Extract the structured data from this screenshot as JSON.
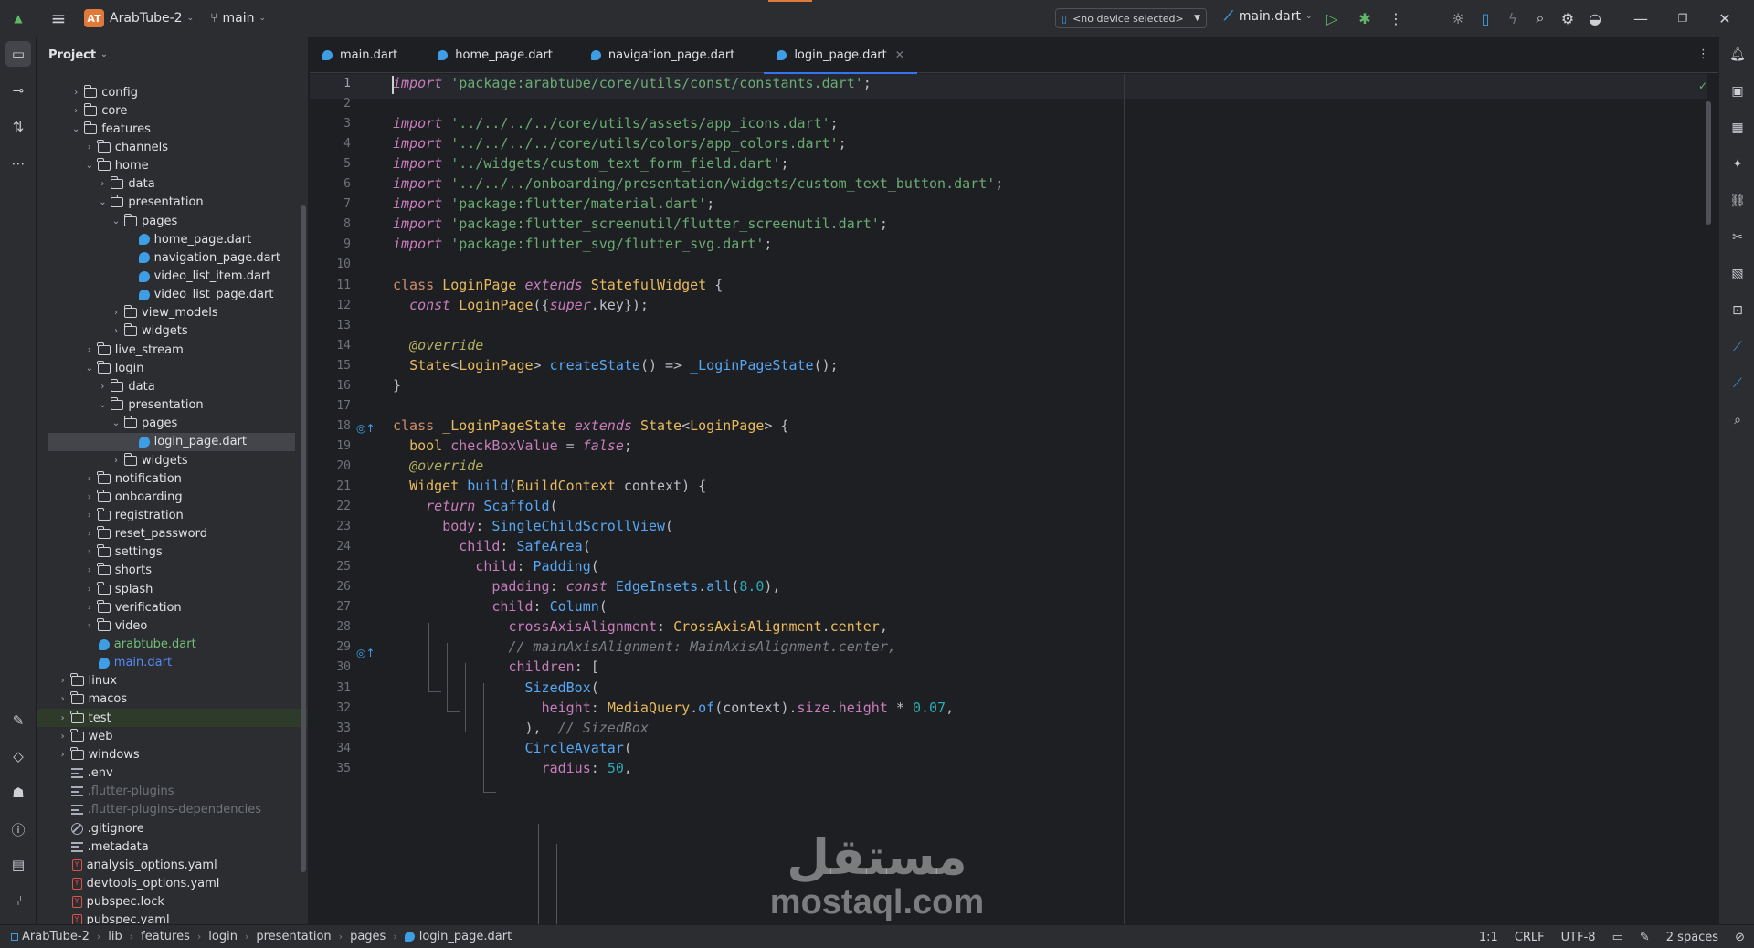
{
  "topbar": {
    "project_badge": "AT",
    "project_name": "ArabTube-2",
    "branch": "main",
    "device": "<no device selected>",
    "run_config": "main.dart"
  },
  "project_panel": {
    "title": "Project",
    "tree": [
      {
        "label": "config",
        "kind": "folder",
        "depth": 2,
        "arrow": "›"
      },
      {
        "label": "core",
        "kind": "folder",
        "depth": 2,
        "arrow": "›"
      },
      {
        "label": "features",
        "kind": "folder",
        "depth": 2,
        "arrow": "⌄"
      },
      {
        "label": "channels",
        "kind": "folder",
        "depth": 3,
        "arrow": "›"
      },
      {
        "label": "home",
        "kind": "folder",
        "depth": 3,
        "arrow": "⌄"
      },
      {
        "label": "data",
        "kind": "folder",
        "depth": 4,
        "arrow": "›"
      },
      {
        "label": "presentation",
        "kind": "folder",
        "depth": 4,
        "arrow": "⌄"
      },
      {
        "label": "pages",
        "kind": "folder",
        "depth": 5,
        "arrow": "⌄"
      },
      {
        "label": "home_page.dart",
        "kind": "dart",
        "depth": 6,
        "arrow": ""
      },
      {
        "label": "navigation_page.dart",
        "kind": "dart",
        "depth": 6,
        "arrow": ""
      },
      {
        "label": "video_list_item.dart",
        "kind": "dart",
        "depth": 6,
        "arrow": ""
      },
      {
        "label": "video_list_page.dart",
        "kind": "dart",
        "depth": 6,
        "arrow": ""
      },
      {
        "label": "view_models",
        "kind": "folder",
        "depth": 5,
        "arrow": "›"
      },
      {
        "label": "widgets",
        "kind": "folder",
        "depth": 5,
        "arrow": "›"
      },
      {
        "label": "live_stream",
        "kind": "folder",
        "depth": 3,
        "arrow": "›"
      },
      {
        "label": "login",
        "kind": "folder",
        "depth": 3,
        "arrow": "⌄"
      },
      {
        "label": "data",
        "kind": "folder",
        "depth": 4,
        "arrow": "›"
      },
      {
        "label": "presentation",
        "kind": "folder",
        "depth": 4,
        "arrow": "⌄"
      },
      {
        "label": "pages",
        "kind": "folder",
        "depth": 5,
        "arrow": "⌄"
      },
      {
        "label": "login_page.dart",
        "kind": "dart",
        "depth": 6,
        "arrow": "",
        "selected": true
      },
      {
        "label": "widgets",
        "kind": "folder",
        "depth": 5,
        "arrow": "›"
      },
      {
        "label": "notification",
        "kind": "folder",
        "depth": 3,
        "arrow": "›"
      },
      {
        "label": "onboarding",
        "kind": "folder",
        "depth": 3,
        "arrow": "›"
      },
      {
        "label": "registration",
        "kind": "folder",
        "depth": 3,
        "arrow": "›"
      },
      {
        "label": "reset_password",
        "kind": "folder",
        "depth": 3,
        "arrow": "›"
      },
      {
        "label": "settings",
        "kind": "folder",
        "depth": 3,
        "arrow": "›"
      },
      {
        "label": "shorts",
        "kind": "folder",
        "depth": 3,
        "arrow": "›"
      },
      {
        "label": "splash",
        "kind": "folder",
        "depth": 3,
        "arrow": "›"
      },
      {
        "label": "verification",
        "kind": "folder",
        "depth": 3,
        "arrow": "›"
      },
      {
        "label": "video",
        "kind": "folder",
        "depth": 3,
        "arrow": "›"
      },
      {
        "label": "arabtube.dart",
        "kind": "dart",
        "depth": 3,
        "arrow": "",
        "style": "green"
      },
      {
        "label": "main.dart",
        "kind": "dart",
        "depth": 3,
        "arrow": "",
        "style": "blue"
      },
      {
        "label": "linux",
        "kind": "folder",
        "depth": 1,
        "arrow": "›"
      },
      {
        "label": "macos",
        "kind": "folder",
        "depth": 1,
        "arrow": "›"
      },
      {
        "label": "test",
        "kind": "folder",
        "depth": 1,
        "arrow": "›",
        "testbg": true
      },
      {
        "label": "web",
        "kind": "folder",
        "depth": 1,
        "arrow": "›"
      },
      {
        "label": "windows",
        "kind": "folder",
        "depth": 1,
        "arrow": "›"
      },
      {
        "label": ".env",
        "kind": "text",
        "depth": 1,
        "arrow": ""
      },
      {
        "label": ".flutter-plugins",
        "kind": "text",
        "depth": 1,
        "arrow": "",
        "style": "dim"
      },
      {
        "label": ".flutter-plugins-dependencies",
        "kind": "text",
        "depth": 1,
        "arrow": "",
        "style": "dim"
      },
      {
        "label": ".gitignore",
        "kind": "ignore",
        "depth": 1,
        "arrow": ""
      },
      {
        "label": ".metadata",
        "kind": "text",
        "depth": 1,
        "arrow": ""
      },
      {
        "label": "analysis_options.yaml",
        "kind": "yaml",
        "depth": 1,
        "arrow": ""
      },
      {
        "label": "devtools_options.yaml",
        "kind": "yaml",
        "depth": 1,
        "arrow": ""
      },
      {
        "label": "pubspec.lock",
        "kind": "yaml",
        "depth": 1,
        "arrow": ""
      },
      {
        "label": "pubspec.yaml",
        "kind": "yaml",
        "depth": 1,
        "arrow": ""
      }
    ]
  },
  "tabs": [
    {
      "label": "main.dart",
      "active": false
    },
    {
      "label": "home_page.dart",
      "active": false
    },
    {
      "label": "navigation_page.dart",
      "active": false
    },
    {
      "label": "login_page.dart",
      "active": true
    }
  ],
  "editor": {
    "current_line": 1,
    "lines": [
      [
        [
          "kwi",
          "import"
        ],
        [
          "p",
          " "
        ],
        [
          "str",
          "'package:arabtube/core/utils/const/constants.dart'"
        ],
        [
          "p",
          ";"
        ]
      ],
      [],
      [
        [
          "kwi",
          "import"
        ],
        [
          "p",
          " "
        ],
        [
          "str",
          "'../../../../core/utils/assets/app_icons.dart'"
        ],
        [
          "p",
          ";"
        ]
      ],
      [
        [
          "kwi",
          "import"
        ],
        [
          "p",
          " "
        ],
        [
          "str",
          "'../../../../core/utils/colors/app_colors.dart'"
        ],
        [
          "p",
          ";"
        ]
      ],
      [
        [
          "kwi",
          "import"
        ],
        [
          "p",
          " "
        ],
        [
          "str",
          "'../widgets/custom_text_form_field.dart'"
        ],
        [
          "p",
          ";"
        ]
      ],
      [
        [
          "kwi",
          "import"
        ],
        [
          "p",
          " "
        ],
        [
          "str",
          "'../../../onboarding/presentation/widgets/custom_text_button.dart'"
        ],
        [
          "p",
          ";"
        ]
      ],
      [
        [
          "kwi",
          "import"
        ],
        [
          "p",
          " "
        ],
        [
          "str",
          "'package:flutter/material.dart'"
        ],
        [
          "p",
          ";"
        ]
      ],
      [
        [
          "kwi",
          "import"
        ],
        [
          "p",
          " "
        ],
        [
          "str",
          "'package:flutter_screenutil/flutter_screenutil.dart'"
        ],
        [
          "p",
          ";"
        ]
      ],
      [
        [
          "kwi",
          "import"
        ],
        [
          "p",
          " "
        ],
        [
          "str",
          "'package:flutter_svg/flutter_svg.dart'"
        ],
        [
          "p",
          ";"
        ]
      ],
      [],
      [
        [
          "kw",
          "class"
        ],
        [
          "p",
          " "
        ],
        [
          "cls",
          "LoginPage"
        ],
        [
          "p",
          " "
        ],
        [
          "kwi",
          "extends"
        ],
        [
          "p",
          " "
        ],
        [
          "cls",
          "StatefulWidget"
        ],
        [
          "p",
          " {"
        ]
      ],
      [
        [
          "p",
          "  "
        ],
        [
          "kwi",
          "const"
        ],
        [
          "p",
          " "
        ],
        [
          "cls",
          "LoginPage"
        ],
        [
          "p",
          "({"
        ],
        [
          "itc",
          "super"
        ],
        [
          "p",
          "."
        ],
        [
          "p",
          "key"
        ],
        [
          "p",
          "});"
        ]
      ],
      [],
      [
        [
          "p",
          "  "
        ],
        [
          "ann",
          "@override"
        ]
      ],
      [
        [
          "p",
          "  "
        ],
        [
          "cls",
          "State"
        ],
        [
          "p",
          "<"
        ],
        [
          "cls",
          "LoginPage"
        ],
        [
          "p",
          "> "
        ],
        [
          "cls2",
          "createState"
        ],
        [
          "p",
          "() => "
        ],
        [
          "cls2",
          "_LoginPageState"
        ],
        [
          "p",
          "();"
        ]
      ],
      [
        [
          "p",
          "}"
        ]
      ],
      [],
      [
        [
          "kw",
          "class"
        ],
        [
          "p",
          " "
        ],
        [
          "cls",
          "_LoginPageState"
        ],
        [
          "p",
          " "
        ],
        [
          "kwi",
          "extends"
        ],
        [
          "p",
          " "
        ],
        [
          "cls",
          "State"
        ],
        [
          "p",
          "<"
        ],
        [
          "cls",
          "LoginPage"
        ],
        [
          "p",
          "> {"
        ]
      ],
      [
        [
          "p",
          "  "
        ],
        [
          "cls",
          "bool"
        ],
        [
          "p",
          " "
        ],
        [
          "fld",
          "checkBoxValue"
        ],
        [
          "p",
          " = "
        ],
        [
          "kwi",
          "false"
        ],
        [
          "p",
          ";"
        ]
      ],
      [
        [
          "p",
          "  "
        ],
        [
          "ann",
          "@override"
        ]
      ],
      [
        [
          "p",
          "  "
        ],
        [
          "cls",
          "Widget"
        ],
        [
          "p",
          " "
        ],
        [
          "cls2",
          "build"
        ],
        [
          "p",
          "("
        ],
        [
          "cls",
          "BuildContext"
        ],
        [
          "p",
          " context) {"
        ]
      ],
      [
        [
          "p",
          "    "
        ],
        [
          "kwi",
          "return"
        ],
        [
          "p",
          " "
        ],
        [
          "cls2",
          "Scaffold"
        ],
        [
          "p",
          "("
        ]
      ],
      [
        [
          "p",
          "      "
        ],
        [
          "fld",
          "body"
        ],
        [
          "p",
          ": "
        ],
        [
          "cls2",
          "SingleChildScrollView"
        ],
        [
          "p",
          "("
        ]
      ],
      [
        [
          "p",
          "        "
        ],
        [
          "fld",
          "child"
        ],
        [
          "p",
          ": "
        ],
        [
          "cls2",
          "SafeArea"
        ],
        [
          "p",
          "("
        ]
      ],
      [
        [
          "p",
          "          "
        ],
        [
          "fld",
          "child"
        ],
        [
          "p",
          ": "
        ],
        [
          "cls2",
          "Padding"
        ],
        [
          "p",
          "("
        ]
      ],
      [
        [
          "p",
          "            "
        ],
        [
          "fld",
          "padding"
        ],
        [
          "p",
          ": "
        ],
        [
          "kwi",
          "const"
        ],
        [
          "p",
          " "
        ],
        [
          "cls2",
          "EdgeInsets"
        ],
        [
          "p",
          "."
        ],
        [
          "cls2",
          "all"
        ],
        [
          "p",
          "("
        ],
        [
          "num",
          "8.0"
        ],
        [
          "p",
          "),"
        ]
      ],
      [
        [
          "p",
          "            "
        ],
        [
          "fld",
          "child"
        ],
        [
          "p",
          ": "
        ],
        [
          "cls2",
          "Column"
        ],
        [
          "p",
          "("
        ]
      ],
      [
        [
          "p",
          "              "
        ],
        [
          "fld",
          "crossAxisAlignment"
        ],
        [
          "p",
          ": "
        ],
        [
          "cls",
          "CrossAxisAlignment"
        ],
        [
          "p",
          "."
        ],
        [
          "cls",
          "center"
        ],
        [
          "p",
          ","
        ]
      ],
      [
        [
          "p",
          "              "
        ],
        [
          "cmt",
          "// mainAxisAlignment: MainAxisAlignment.center,"
        ]
      ],
      [
        [
          "p",
          "              "
        ],
        [
          "fld",
          "children"
        ],
        [
          "p",
          ": ["
        ]
      ],
      [
        [
          "p",
          "                "
        ],
        [
          "cls2",
          "SizedBox"
        ],
        [
          "p",
          "("
        ]
      ],
      [
        [
          "p",
          "                  "
        ],
        [
          "fld",
          "height"
        ],
        [
          "p",
          ": "
        ],
        [
          "cls",
          "MediaQuery"
        ],
        [
          "p",
          "."
        ],
        [
          "cls2",
          "of"
        ],
        [
          "p",
          "(context)."
        ],
        [
          "fld",
          "size"
        ],
        [
          "p",
          "."
        ],
        [
          "fld",
          "height"
        ],
        [
          "p",
          " * "
        ],
        [
          "num",
          "0.07"
        ],
        [
          "p",
          ","
        ]
      ],
      [
        [
          "p",
          "                ),  "
        ],
        [
          "cmt",
          "// SizedBox"
        ]
      ],
      [
        [
          "p",
          "                "
        ],
        [
          "cls2",
          "CircleAvatar"
        ],
        [
          "p",
          "("
        ]
      ],
      [
        [
          "p",
          "                  "
        ],
        [
          "fld",
          "radius"
        ],
        [
          "p",
          ": "
        ],
        [
          "num",
          "50"
        ],
        [
          "p",
          ","
        ]
      ]
    ]
  },
  "statusbar": {
    "crumbs": [
      "ArabTube-2",
      "lib",
      "features",
      "login",
      "presentation",
      "pages",
      "login_page.dart"
    ],
    "position": "1:1",
    "line_sep": "CRLF",
    "encoding": "UTF-8",
    "indent": "2 spaces"
  },
  "watermark": {
    "arabic": "مستقل",
    "latin": "mostaql.com"
  }
}
